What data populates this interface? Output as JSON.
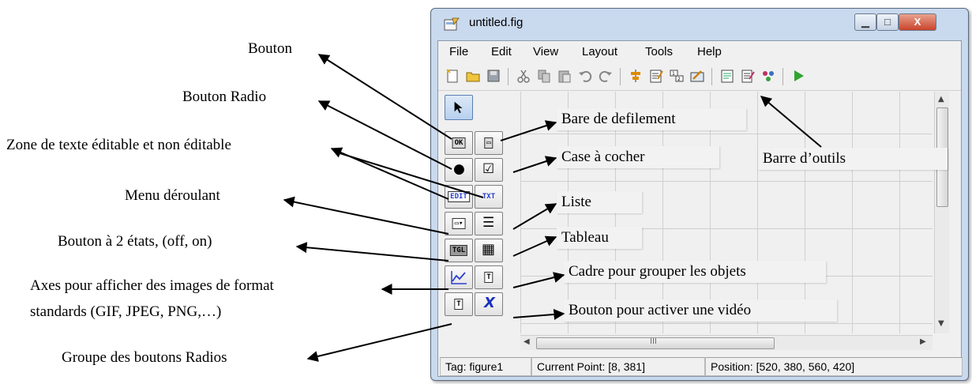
{
  "annotations": {
    "bouton": "Bouton",
    "bouton_radio": "Bouton Radio",
    "zone_texte": "Zone de texte éditable et non éditable",
    "menu_deroulant": "Menu déroulant",
    "bouton_2_etats": "Bouton à 2 états, (off, on)",
    "axes_line1": "Axes pour afficher des images de format",
    "axes_line2": "standards (GIF, JPEG, PNG,…)",
    "groupe_radios": "Groupe des boutons Radios",
    "bare_defilement": "Bare de defilement",
    "case_cocher": "Case à cocher",
    "liste": "Liste",
    "tableau": "Tableau",
    "cadre": "Cadre pour grouper les objets",
    "bouton_video": "Bouton pour activer une vidéo",
    "barre_outils": "Barre d’outils"
  },
  "window": {
    "title": "untitled.fig",
    "controls": {
      "minimize": "▁",
      "maximize": "□",
      "close": "X"
    }
  },
  "menu": [
    "File",
    "Edit",
    "View",
    "Layout",
    "Tools",
    "Help"
  ],
  "palette": {
    "push_button": "OK",
    "slider": "▭",
    "radio": "●",
    "checkbox": "☑",
    "edit_text": "EDIT",
    "static_text": "TXT",
    "popup": "▭▾",
    "listbox": "☰",
    "toggle": "TGL",
    "table": "▦",
    "axes": "⟋",
    "panel": "T",
    "button_group": "T",
    "activex": "X"
  },
  "hscroll_thumb": "III",
  "status": {
    "tag": "Tag: figure1",
    "current_point": "Current Point:  [8, 381]",
    "position": "Position: [520, 380, 560, 420]"
  },
  "colors": {
    "run_icon": "#2fa52f",
    "close_button": "#c9442a",
    "window_frame": "#c9d9ee"
  }
}
